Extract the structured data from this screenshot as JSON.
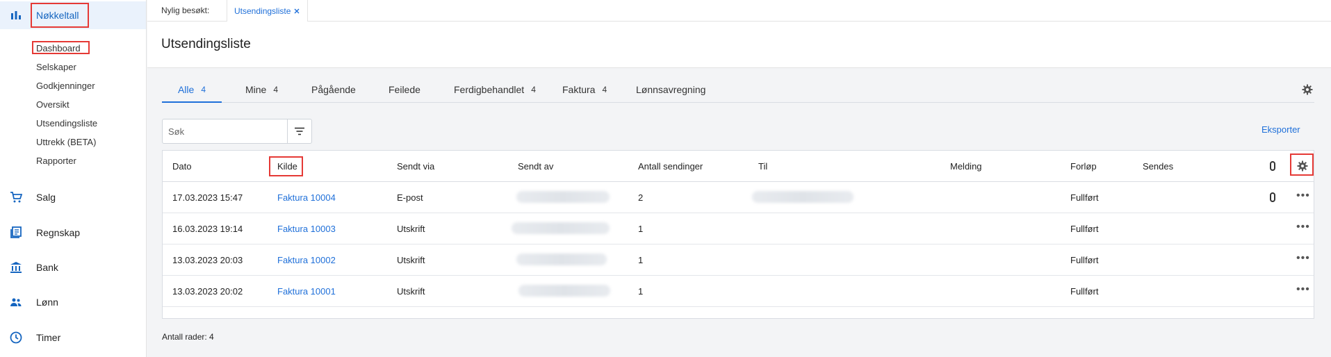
{
  "sidebar": {
    "main_items": [
      {
        "label": "Nøkkeltall",
        "icon": "bar-chart-icon"
      },
      {
        "label": "Salg",
        "icon": "cart-icon"
      },
      {
        "label": "Regnskap",
        "icon": "ledger-icon"
      },
      {
        "label": "Bank",
        "icon": "bank-icon"
      },
      {
        "label": "Lønn",
        "icon": "people-icon"
      },
      {
        "label": "Timer",
        "icon": "clock-icon"
      }
    ],
    "sub_items": [
      "Dashboard",
      "Selskaper",
      "Godkjenninger",
      "Oversikt",
      "Utsendingsliste",
      "Uttrekk (BETA)",
      "Rapporter"
    ]
  },
  "topbar": {
    "recent_label": "Nylig besøkt:",
    "recent_tab": "Utsendingsliste"
  },
  "page": {
    "title": "Utsendingsliste"
  },
  "tabs": [
    {
      "label": "Alle",
      "count": "4"
    },
    {
      "label": "Mine",
      "count": "4"
    },
    {
      "label": "Pågående",
      "count": ""
    },
    {
      "label": "Feilede",
      "count": ""
    },
    {
      "label": "Ferdigbehandlet",
      "count": "4"
    },
    {
      "label": "Faktura",
      "count": "4"
    },
    {
      "label": "Lønnsavregning",
      "count": ""
    }
  ],
  "search": {
    "placeholder": "Søk"
  },
  "export_label": "Eksporter",
  "table": {
    "columns": [
      "Dato",
      "Kilde",
      "Sendt via",
      "Sendt av",
      "Antall sendinger",
      "Til",
      "Melding",
      "Forløp",
      "Sendes"
    ],
    "rows": [
      {
        "dato": "17.03.2023 15:47",
        "kilde": "Faktura 10004",
        "sendt_via": "E-post",
        "antall": "2",
        "forlop": "Fullført"
      },
      {
        "dato": "16.03.2023 19:14",
        "kilde": "Faktura 10003",
        "sendt_via": "Utskrift",
        "antall": "1",
        "forlop": "Fullført"
      },
      {
        "dato": "13.03.2023 20:03",
        "kilde": "Faktura 10002",
        "sendt_via": "Utskrift",
        "antall": "1",
        "forlop": "Fullført"
      },
      {
        "dato": "13.03.2023 20:02",
        "kilde": "Faktura 10001",
        "sendt_via": "Utskrift",
        "antall": "1",
        "forlop": "Fullført"
      }
    ]
  },
  "footer": {
    "row_count_label": "Antall rader:",
    "row_count": "4"
  },
  "colors": {
    "accent": "#1e6fd9",
    "highlight": "#e53935"
  }
}
